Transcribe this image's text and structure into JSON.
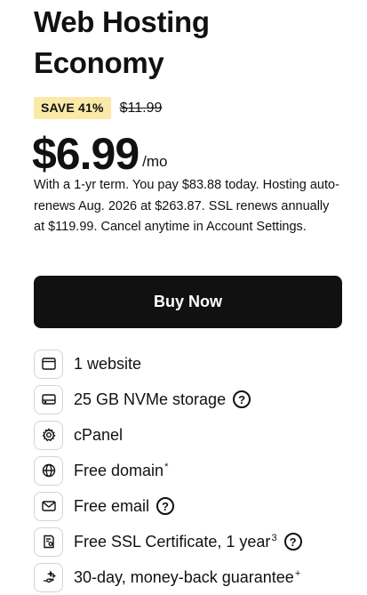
{
  "plan": {
    "title_line1": "Web Hosting",
    "title_line2": "Economy",
    "save_badge": "SAVE 41%",
    "old_price": "$11.99",
    "price": "$6.99",
    "per": "/mo",
    "terms": "With a 1-yr term. You pay $83.88 today. Hosting auto-renews Aug. 2026 at $263.87. SSL renews annually at $119.99. Cancel anytime in Account Settings.",
    "buy_label": "Buy Now"
  },
  "features": [
    {
      "icon": "browser-window-icon",
      "label": "1 website",
      "sup": "",
      "help": false
    },
    {
      "icon": "storage-drive-icon",
      "label": "25 GB NVMe storage",
      "sup": "",
      "help": true
    },
    {
      "icon": "gear-icon",
      "label": "cPanel",
      "sup": "",
      "help": false
    },
    {
      "icon": "globe-icon",
      "label": "Free domain",
      "sup": "*",
      "help": false
    },
    {
      "icon": "envelope-icon",
      "label": "Free email",
      "sup": "",
      "help": true
    },
    {
      "icon": "ssl-certificate-icon",
      "label": "Free SSL Certificate, 1 year",
      "sup": "3",
      "help": true
    },
    {
      "icon": "sparkle-hand-icon",
      "label": "30-day, money-back guarantee",
      "sup": "+",
      "help": false
    }
  ],
  "help_glyph": "?",
  "colors": {
    "badge_bg": "#fbe9a8",
    "button_bg": "#111111",
    "text": "#111111"
  }
}
